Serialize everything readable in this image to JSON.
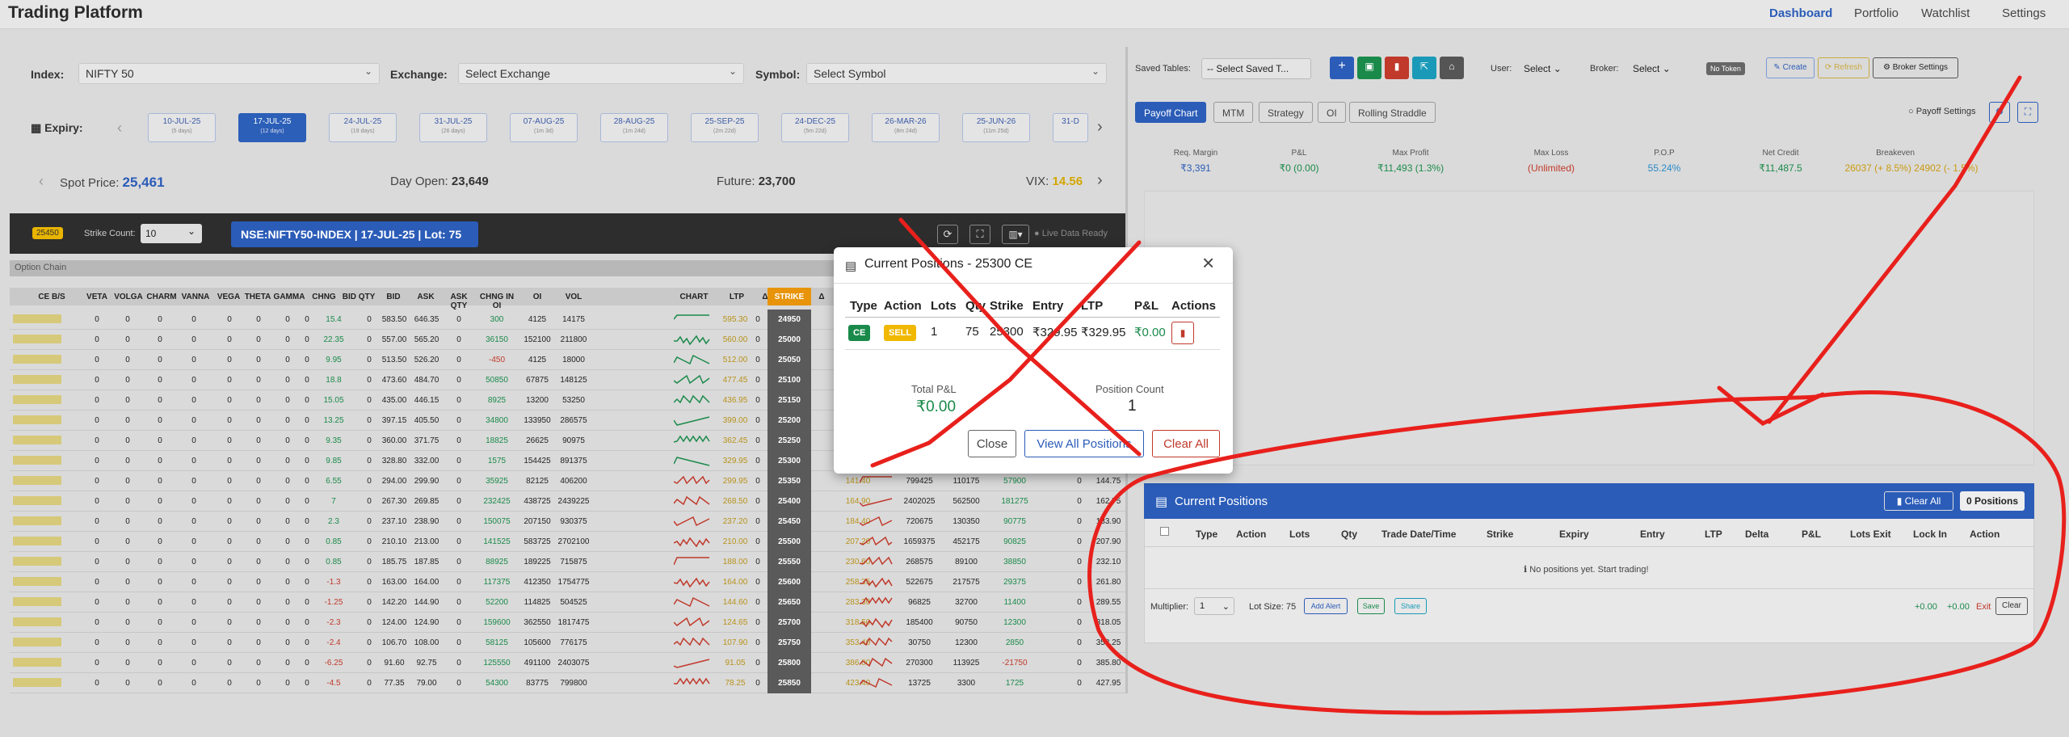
{
  "navbar": {
    "brand": "Trading Platform",
    "links": [
      "Dashboard",
      "Portfolio",
      "Watchlist",
      "Settings"
    ]
  },
  "filters": {
    "index_label": "Index:",
    "index_value": "NIFTY 50",
    "exchange_label": "Exchange:",
    "exchange_value": "Select Exchange",
    "symbol_label": "Symbol:",
    "symbol_value": "Select Symbol"
  },
  "expiry": {
    "label": "Expiry:",
    "dates": [
      {
        "date": "10-JUL-25",
        "note": "(5 days)"
      },
      {
        "date": "17-JUL-25",
        "note": "(12 days)"
      },
      {
        "date": "24-JUL-25",
        "note": "(19 days)"
      },
      {
        "date": "31-JUL-25",
        "note": "(26 days)"
      },
      {
        "date": "07-AUG-25",
        "note": "(1m 3d)"
      },
      {
        "date": "28-AUG-25",
        "note": "(1m 24d)"
      },
      {
        "date": "25-SEP-25",
        "note": "(2m 22d)"
      },
      {
        "date": "24-DEC-25",
        "note": "(5m 22d)"
      },
      {
        "date": "26-MAR-26",
        "note": "(8m 24d)"
      },
      {
        "date": "25-JUN-26",
        "note": "(11m 25d)"
      },
      {
        "date": "31-D",
        "note": ""
      }
    ]
  },
  "market": {
    "spot_label": "Spot Price:",
    "spot_value": "25,461",
    "open_label": "Day Open:",
    "open_value": "23,649",
    "future_label": "Future:",
    "future_value": "23,700",
    "vix_label": "VIX:",
    "vix_value": "14.56"
  },
  "chain_bar": {
    "badge": "25450",
    "strike_count_label": "Strike Count:",
    "strike_count": "10",
    "title": "NSE:NIFTY50-INDEX | 17-JUL-25 | Lot: 75",
    "live_label": "Live Data Ready"
  },
  "option_chain": {
    "section_label": "Option Chain",
    "headers": [
      "CE B/S",
      "VETA",
      "VOLGA",
      "CHARM",
      "VANNA",
      "VEGA",
      "THETA",
      "GAMMA",
      "CHNG",
      "BID QTY",
      "BID",
      "ASK",
      "ASK QTY",
      "CHNG IN OI",
      "OI",
      "VOL",
      "CHART",
      "LTP",
      "Δ",
      "STRIKE",
      "Δ"
    ],
    "rows": [
      {
        "chng": "15.4",
        "bid": "583.50",
        "ask": "646.35",
        "chng_oi": "300",
        "oi": "4125",
        "vol": "14175",
        "ltp": "595.30",
        "strike": "24950"
      },
      {
        "chng": "22.35",
        "bid": "557.00",
        "ask": "565.20",
        "chng_oi": "36150",
        "oi": "152100",
        "vol": "211800",
        "ltp": "560.00",
        "strike": "25000"
      },
      {
        "chng": "9.95",
        "bid": "513.50",
        "ask": "526.20",
        "chng_oi": "-450",
        "oi": "4125",
        "vol": "18000",
        "ltp": "512.00",
        "strike": "25050"
      },
      {
        "chng": "18.8",
        "bid": "473.60",
        "ask": "484.70",
        "chng_oi": "50850",
        "oi": "67875",
        "vol": "148125",
        "ltp": "477.45",
        "strike": "25100"
      },
      {
        "chng": "15.05",
        "bid": "435.00",
        "ask": "446.15",
        "chng_oi": "8925",
        "oi": "13200",
        "vol": "53250",
        "ltp": "436.95",
        "strike": "25150"
      },
      {
        "chng": "13.25",
        "bid": "397.15",
        "ask": "405.50",
        "chng_oi": "34800",
        "oi": "133950",
        "vol": "286575",
        "ltp": "399.00",
        "strike": "25200"
      },
      {
        "chng": "9.35",
        "bid": "360.00",
        "ask": "371.75",
        "chng_oi": "18825",
        "oi": "26625",
        "vol": "90975",
        "ltp": "362.45",
        "strike": "25250"
      },
      {
        "chng": "9.85",
        "bid": "328.80",
        "ask": "332.00",
        "chng_oi": "1575",
        "oi": "154425",
        "vol": "891375",
        "ltp": "329.95",
        "strike": "25300"
      },
      {
        "chng": "6.55",
        "bid": "294.00",
        "ask": "299.90",
        "chng_oi": "35925",
        "oi": "82125",
        "vol": "406200",
        "ltp": "299.95",
        "strike": "25350"
      },
      {
        "chng": "7",
        "bid": "267.30",
        "ask": "269.85",
        "chng_oi": "232425",
        "oi": "438725",
        "vol": "2439225",
        "ltp": "268.50",
        "strike": "25400"
      },
      {
        "chng": "2.3",
        "bid": "237.10",
        "ask": "238.90",
        "chng_oi": "150075",
        "oi": "207150",
        "vol": "930375",
        "ltp": "237.20",
        "strike": "25450"
      },
      {
        "chng": "0.85",
        "bid": "210.10",
        "ask": "213.00",
        "chng_oi": "141525",
        "oi": "583725",
        "vol": "2702100",
        "ltp": "210.00",
        "strike": "25500"
      },
      {
        "chng": "0.85",
        "bid": "185.75",
        "ask": "187.85",
        "chng_oi": "88925",
        "oi": "189225",
        "vol": "715875",
        "ltp": "188.00",
        "strike": "25550"
      },
      {
        "chng": "-1.3",
        "bid": "163.00",
        "ask": "164.00",
        "chng_oi": "117375",
        "oi": "412350",
        "vol": "1754775",
        "ltp": "164.00",
        "strike": "25600"
      },
      {
        "chng": "-1.25",
        "bid": "142.20",
        "ask": "144.90",
        "chng_oi": "52200",
        "oi": "114825",
        "vol": "504525",
        "ltp": "144.60",
        "strike": "25650"
      },
      {
        "chng": "-2.3",
        "bid": "124.00",
        "ask": "124.90",
        "chng_oi": "159600",
        "oi": "362550",
        "vol": "1817475",
        "ltp": "124.65",
        "strike": "25700"
      },
      {
        "chng": "-2.4",
        "bid": "106.70",
        "ask": "108.00",
        "chng_oi": "58125",
        "oi": "105600",
        "vol": "776175",
        "ltp": "107.90",
        "strike": "25750"
      },
      {
        "chng": "-6.25",
        "bid": "91.60",
        "ask": "92.75",
        "chng_oi": "125550",
        "oi": "491100",
        "vol": "2403075",
        "ltp": "91.05",
        "strike": "25800"
      },
      {
        "chng": "-4.5",
        "bid": "77.35",
        "ask": "79.00",
        "chng_oi": "54300",
        "oi": "83775",
        "vol": "799800",
        "ltp": "78.25",
        "strike": "25850"
      }
    ],
    "pe_rows": [
      {
        "row": 8,
        "a": "141.40",
        "b": "799425",
        "c": "110175",
        "d": "57900",
        "e": "0",
        "f": "144.75"
      },
      {
        "row": 9,
        "a": "164.90",
        "b": "2402025",
        "c": "562500",
        "d": "181275",
        "e": "0",
        "f": "162.75"
      },
      {
        "row": 10,
        "a": "184.40",
        "b": "720675",
        "c": "130350",
        "d": "90775",
        "e": "0",
        "f": "183.90"
      },
      {
        "row": 11,
        "a": "207.20",
        "b": "1659375",
        "c": "452175",
        "d": "90825",
        "e": "0",
        "f": "207.90"
      },
      {
        "row": 12,
        "a": "230.60",
        "b": "268575",
        "c": "89100",
        "d": "38850",
        "e": "0",
        "f": "232.10"
      },
      {
        "row": 13,
        "a": "258.35",
        "b": "522675",
        "c": "217575",
        "d": "29375",
        "e": "0",
        "f": "261.80"
      },
      {
        "row": 14,
        "a": "283.30",
        "b": "96825",
        "c": "32700",
        "d": "11400",
        "e": "0",
        "f": "289.55"
      },
      {
        "row": 15,
        "a": "318.50",
        "b": "185400",
        "c": "90750",
        "d": "12300",
        "e": "0",
        "f": "318.05"
      },
      {
        "row": 16,
        "a": "353.40",
        "b": "30750",
        "c": "12300",
        "d": "2850",
        "e": "0",
        "f": "358.25"
      },
      {
        "row": 17,
        "a": "386.00",
        "b": "270300",
        "c": "113925",
        "d": "-21750",
        "e": "0",
        "f": "385.80"
      },
      {
        "row": 18,
        "a": "423.40",
        "b": "13725",
        "c": "3300",
        "d": "1725",
        "e": "0",
        "f": "427.95"
      }
    ]
  },
  "toolbar": {
    "saved_tables_label": "Saved Tables:",
    "saved_tables_value": "-- Select Saved T...",
    "user_label": "User:",
    "user_value": "Select",
    "broker_label": "Broker:",
    "broker_value": "Select",
    "no_token": "No Token",
    "create": "Create",
    "refresh": "Refresh",
    "broker_settings": "Broker Settings"
  },
  "tabs": [
    "Payoff Chart",
    "MTM",
    "Strategy",
    "OI",
    "Rolling Straddle"
  ],
  "payoff_settings_label": "Payoff Settings",
  "metrics": [
    {
      "label": "Req. Margin",
      "value": "₹3,391",
      "color": "#2b5cb8"
    },
    {
      "label": "P&L",
      "value": "₹0 (0.00)",
      "color": "#1a8a4a"
    },
    {
      "label": "Max Profit",
      "value": "₹11,493 (1.3%)",
      "color": "#1a8a4a"
    },
    {
      "label": "Max Loss",
      "value": "(Unlimited)",
      "color": "#c0392b"
    },
    {
      "label": "P.O.P",
      "value": "55.24%",
      "color": "#2b8ac8"
    },
    {
      "label": "Net Credit",
      "value": "₹11,487.5",
      "color": "#1a8a4a"
    },
    {
      "label": "Breakeven",
      "value": "26037 (+ 8.5%) 24902 (- 1.5%)",
      "color": "#c99a10"
    }
  ],
  "current_positions": {
    "title": "Current Positions",
    "clear_all": "Clear All",
    "count": "0 Positions",
    "columns": [
      "Type",
      "Action",
      "Lots",
      "Qty",
      "Trade Date/Time",
      "Strike",
      "Expiry",
      "Entry",
      "LTP",
      "Delta",
      "P&L",
      "Lots Exit",
      "Lock In",
      "Action"
    ],
    "empty": "No positions yet. Start trading!",
    "multiplier_label": "Multiplier:",
    "multiplier_value": "1",
    "lot_size": "Lot Size: 75",
    "add_alert": "Add Alert",
    "save": "Save",
    "share": "Share",
    "pl1": "+0.00",
    "pl2": "+0.00",
    "exit": "Exit",
    "clear": "Clear"
  },
  "modal": {
    "title": "Current Positions - 25300 CE",
    "headers": [
      "Type",
      "Action",
      "Lots",
      "Qty",
      "Strike",
      "Entry",
      "LTP",
      "P&L",
      "Actions"
    ],
    "row": {
      "type": "CE",
      "action": "SELL",
      "lots": "1",
      "qty": "75",
      "strike": "25300",
      "entry": "₹329.95",
      "ltp": "₹329.95",
      "pl": "₹0.00"
    },
    "total_label": "Total P&L",
    "total_value": "₹0.00",
    "count_label": "Position Count",
    "count_value": "1",
    "close": "Close",
    "view_all": "View All Positions",
    "clear_all": "Clear All"
  },
  "colors": {
    "primary": "#2b5cb8",
    "success": "#1a8a4a",
    "danger": "#c0392b",
    "warning": "#e8b400",
    "annotation": "#e8201c"
  }
}
